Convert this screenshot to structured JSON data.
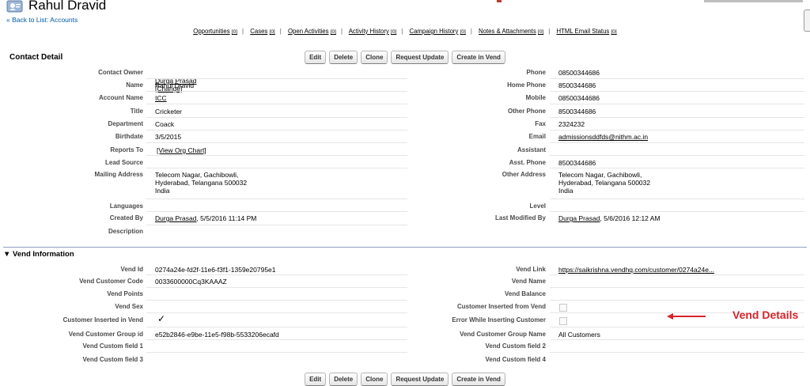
{
  "header": {
    "title": "Rahul Dravid",
    "back_link": "« Back to List: Accounts"
  },
  "related_links": [
    {
      "label": "Opportunities",
      "count": "[0]"
    },
    {
      "label": "Cases",
      "count": "[0]"
    },
    {
      "label": "Open Activities",
      "count": "[0]"
    },
    {
      "label": "Activity History",
      "count": "[0]"
    },
    {
      "label": "Campaign History",
      "count": "[0]"
    },
    {
      "label": "Notes & Attachments",
      "count": "[0]"
    },
    {
      "label": "HTML Email Status",
      "count": "[0]"
    }
  ],
  "buttons": {
    "edit": "Edit",
    "delete": "Delete",
    "clone": "Clone",
    "request_update": "Request Update",
    "create_in_vend": "Create in Vend"
  },
  "contact_detail": {
    "title": "Contact Detail",
    "contact_owner": {
      "label": "Contact Owner",
      "name": "Durga Prasad",
      "change": "[Change]"
    },
    "name": {
      "label": "Name",
      "value": "Rahul Dravid"
    },
    "account_name": {
      "label": "Account Name",
      "value": "ICC"
    },
    "title_field": {
      "label": "Title",
      "value": "Cricketer"
    },
    "department": {
      "label": "Department",
      "value": "Coack"
    },
    "birthdate": {
      "label": "Birthdate",
      "value": "3/5/2015"
    },
    "reports_to": {
      "label": "Reports To",
      "value": "[View Org Chart]"
    },
    "lead_source": {
      "label": "Lead Source",
      "value": ""
    },
    "mailing_address": {
      "label": "Mailing Address",
      "value": "Telecom Nagar, Gachibowli,\nHyderabad, Telangana 500032\nIndia"
    },
    "languages": {
      "label": "Languages",
      "value": ""
    },
    "created_by": {
      "label": "Created By",
      "user": "Durga Prasad",
      "date": ", 5/5/2016 11:14 PM"
    },
    "description": {
      "label": "Description",
      "value": ""
    },
    "phone": {
      "label": "Phone",
      "value": "08500344686"
    },
    "home_phone": {
      "label": "Home Phone",
      "value": "8500344686"
    },
    "mobile": {
      "label": "Mobile",
      "value": "08500344686"
    },
    "other_phone": {
      "label": "Other Phone",
      "value": "8500344686"
    },
    "fax": {
      "label": "Fax",
      "value": "2324232"
    },
    "email": {
      "label": "Email",
      "value": "admissionsddfds@nithm.ac.in"
    },
    "assistant": {
      "label": "Assistant",
      "value": ""
    },
    "asst_phone": {
      "label": "Asst. Phone",
      "value": "8500344686"
    },
    "other_address": {
      "label": "Other Address",
      "value": "Telecom Nagar, Gachibowli,\nHyderabad, Telangana 500032\nIndia"
    },
    "level": {
      "label": "Level",
      "value": ""
    },
    "last_modified_by": {
      "label": "Last Modified By",
      "user": "Durga Prasad",
      "date": ", 5/6/2016 12:12 AM"
    }
  },
  "vend_information": {
    "title": "▼ Vend Information",
    "vend_id": {
      "label": "Vend Id",
      "value": "0274a24e-fd2f-11e6-f3f1-1359e20795e1"
    },
    "vend_customer_code": {
      "label": "Vend Customer Code",
      "value": "0033600000Cq3KAAAZ"
    },
    "vend_points": {
      "label": "Vend Points",
      "value": ""
    },
    "vend_sex": {
      "label": "Vend Sex",
      "value": ""
    },
    "customer_inserted_in_vend": {
      "label": "Customer Inserted in Vend",
      "checked": true
    },
    "vend_customer_group_id": {
      "label": "Vend Customer Group id",
      "value": "e52b2846-e9be-11e5-f98b-5533206ecafd"
    },
    "vend_custom_field_1": {
      "label": "Vend Custom field 1",
      "value": ""
    },
    "vend_custom_field_3": {
      "label": "Vend Custom field 3",
      "value": ""
    },
    "vend_link": {
      "label": "Vend Link",
      "value": "https://saikrishna.vendhq.com/customer/0274a24e..."
    },
    "vend_name": {
      "label": "Vend Name",
      "value": ""
    },
    "vend_balance": {
      "label": "Vend Balance",
      "value": ""
    },
    "customer_inserted_from_vend": {
      "label": "Customer Inserted from Vend",
      "checked": false
    },
    "error_while_inserting_customer": {
      "label": "Error While Inserting Customer",
      "checked": false
    },
    "vend_customer_group_name": {
      "label": "Vend Customer Group Name",
      "value": "All Customers"
    },
    "vend_custom_field_2": {
      "label": "Vend Custom field 2",
      "value": ""
    },
    "vend_custom_field_4": {
      "label": "Vend Custom field 4",
      "value": ""
    }
  },
  "annotation": {
    "label": "Vend Details"
  }
}
